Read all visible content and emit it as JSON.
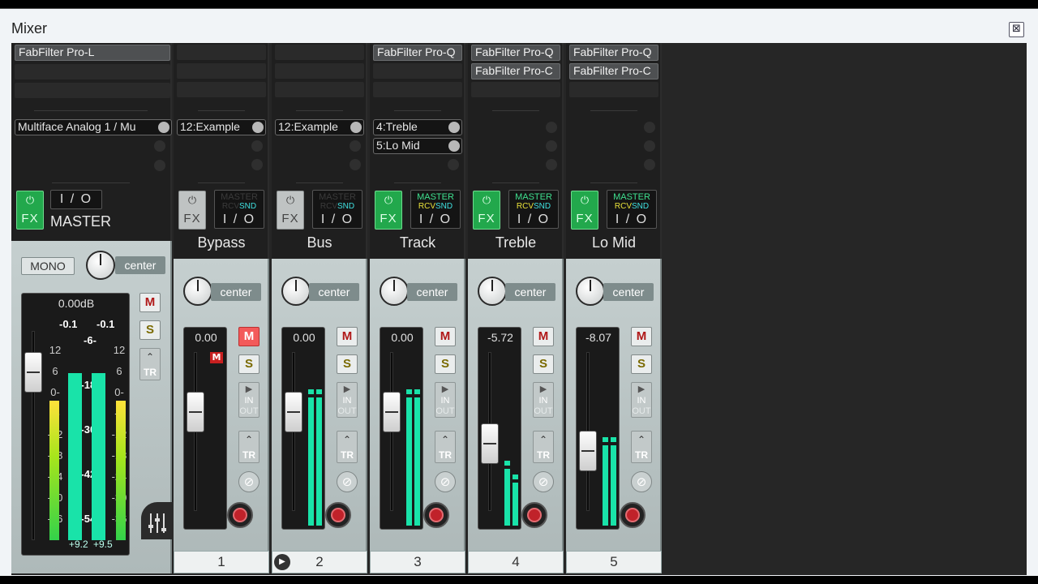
{
  "window": {
    "title": "Mixer",
    "close_icon": "⊠"
  },
  "master": {
    "fx": "FabFilter Pro-L",
    "send": "Multiface Analog 1 / Mu",
    "io": "I / O",
    "fx_label": "FX",
    "power_icon": "⏻",
    "name": "MASTER",
    "mono": "MONO",
    "pan": "center",
    "volume": "0.00dB",
    "peak_l": "-0.1",
    "peak_r": "-0.1",
    "mute": "M",
    "solo": "S",
    "tr": "TR",
    "env_icon": "⌃",
    "scale": [
      "12",
      "6",
      "0-",
      "-6",
      "-12",
      "-18",
      "-24",
      "-30",
      "-36"
    ],
    "inner_scale": [
      "-6-",
      "-18-",
      "-30-",
      "-42-",
      "-54-"
    ],
    "rms_l": "+9.2",
    "rms_r": "+9.5",
    "meter_levels": [
      0.86,
      0.86
    ],
    "fader_position": 0.88
  },
  "tracks": [
    {
      "name": "Bypass",
      "number": "1",
      "fx": [],
      "sends": [
        "12:Example"
      ],
      "fx_on": false,
      "master_send_active": false,
      "volume": "0.00",
      "pan": "center",
      "mute_on": true,
      "meter_levels": [
        0,
        0
      ],
      "fader_position": 0.72
    },
    {
      "name": "Bus",
      "number": "2",
      "fx": [],
      "sends": [
        "12:Example"
      ],
      "fx_on": false,
      "master_send_active": false,
      "volume": "0.00",
      "pan": "center",
      "mute_on": false,
      "meter_levels": [
        0.72,
        0.72
      ],
      "fader_position": 0.72
    },
    {
      "name": "Track",
      "number": "3",
      "fx": [
        "FabFilter Pro-Q"
      ],
      "sends": [
        "4:Treble",
        "5:Lo Mid"
      ],
      "fx_on": true,
      "master_send_active": true,
      "volume": "0.00",
      "pan": "center",
      "mute_on": false,
      "meter_levels": [
        0.72,
        0.72
      ],
      "fader_position": 0.72
    },
    {
      "name": "Treble",
      "number": "4",
      "fx": [
        "FabFilter Pro-Q",
        "FabFilter Pro-C"
      ],
      "sends": [],
      "fx_on": true,
      "master_send_active": true,
      "volume": "-5.72",
      "pan": "center",
      "mute_on": false,
      "meter_levels": [
        0.32,
        0.24
      ],
      "fader_position": 0.5
    },
    {
      "name": "Lo Mid",
      "number": "5",
      "fx": [
        "FabFilter Pro-Q",
        "FabFilter Pro-C"
      ],
      "sends": [],
      "fx_on": true,
      "master_send_active": true,
      "volume": "-8.07",
      "pan": "center",
      "mute_on": false,
      "meter_levels": [
        0.45,
        0.45
      ],
      "fader_position": 0.45
    }
  ],
  "strip_labels": {
    "mute": "M",
    "solo": "S",
    "in": "IN",
    "out": "OUT",
    "tr": "TR",
    "fx": "FX",
    "io": "I / O",
    "master": "MASTER",
    "rcv": "RCV",
    "snd": "SND",
    "phase_icon": "⊘",
    "play_icon": "▶",
    "power_icon": "⏻",
    "env_icon": "⌃"
  },
  "colors": {
    "fx_on": "#22a84c",
    "meter": "#19e3a9",
    "mute_on": "#f35a5a",
    "strip_bg": "#b5c0c0",
    "dark_bg": "#1f1f1f"
  }
}
